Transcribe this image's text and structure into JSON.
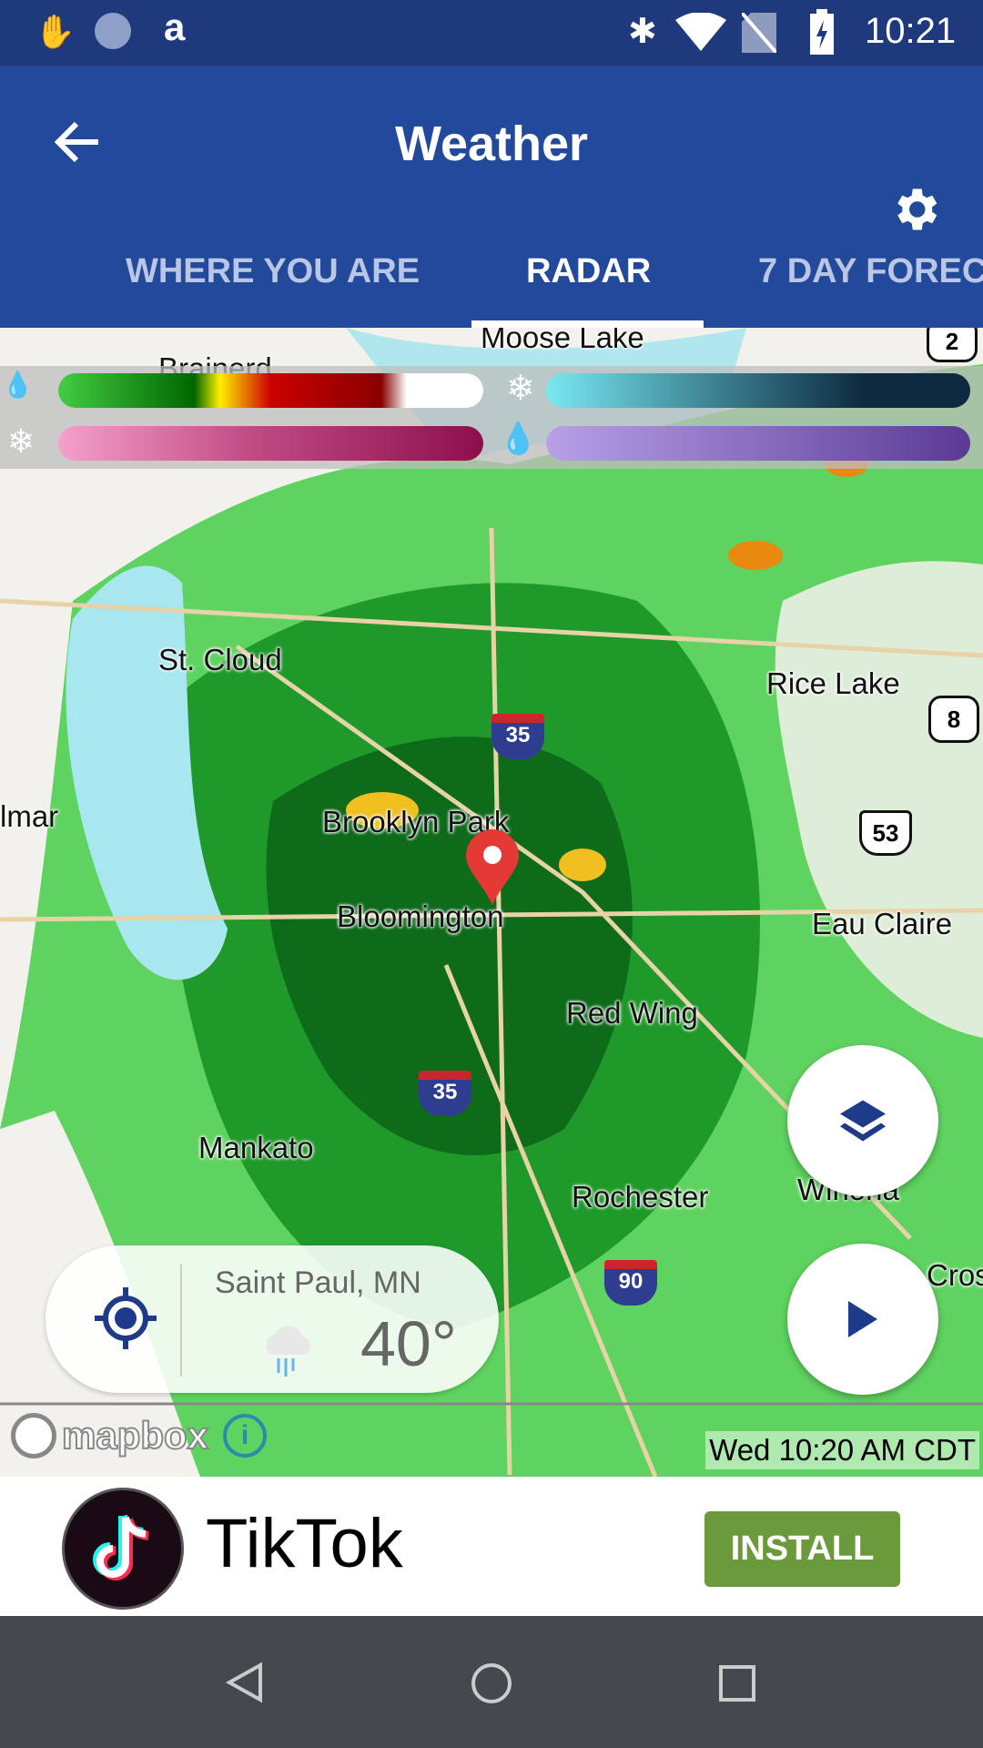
{
  "status_bar": {
    "time": "10:21",
    "icons": [
      "hand-icon",
      "sync-icon",
      "amazon-icon",
      "bluetooth-icon",
      "wifi-icon",
      "no-sim-icon",
      "battery-charging-icon"
    ]
  },
  "app_bar": {
    "title": "Weather",
    "back_icon": "arrow-left-icon",
    "settings_icon": "gear-icon"
  },
  "tabs": [
    {
      "label": "WHERE YOU ARE",
      "active": false
    },
    {
      "label": "RADAR",
      "active": true
    },
    {
      "label": "7 DAY FOREC",
      "active": false
    }
  ],
  "legend": {
    "rain_colors": [
      "#44cc44",
      "#006600",
      "#ffee00",
      "#cc0000",
      "#880000",
      "#ffffff"
    ],
    "snow_colors": [
      "#7ae8f0",
      "#0d2a40"
    ],
    "mix_colors": [
      "#f5a0cc",
      "#8c0f4c"
    ],
    "ice_colors": [
      "#b8a0e8",
      "#5a3a94"
    ]
  },
  "map": {
    "cities": [
      "Moose Lake",
      "Brainerd",
      "St. Cloud",
      "Rice Lake",
      "lmar",
      "Brooklyn Park",
      "Bloomington",
      "Eau Claire",
      "Red Wing",
      "Mankato",
      "Rochester",
      "Winona",
      "Cros"
    ],
    "shields": [
      "35",
      "35",
      "90",
      "53",
      "8",
      "2"
    ],
    "attribution": "mapbox",
    "timestamp": "Wed 10:20 AM CDT"
  },
  "location_card": {
    "city": "Saint Paul, MN",
    "temperature": "40°",
    "condition_icon": "rain-cloud-icon"
  },
  "ad": {
    "app_name": "TikTok",
    "button": "INSTALL",
    "button_color": "#6b9a3c"
  },
  "colors": {
    "status_bar": "#1e3a7c",
    "app_bar": "#234a9a",
    "accent": "#1e3a8a"
  }
}
